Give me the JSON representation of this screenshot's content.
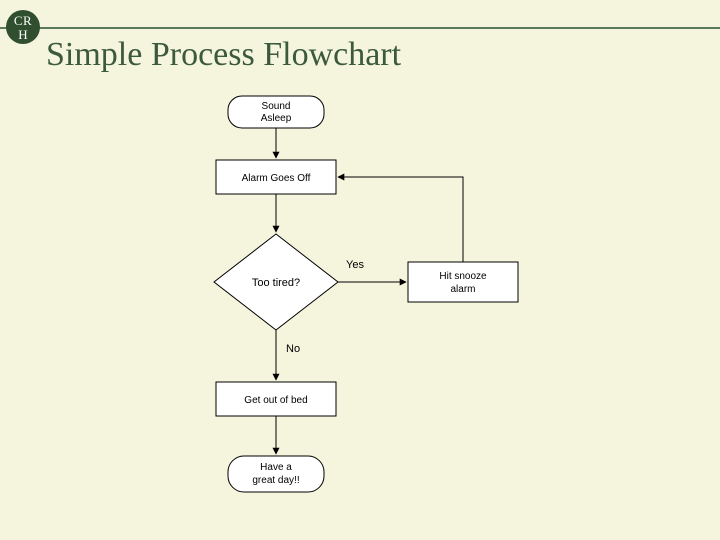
{
  "logo": {
    "top": "CR",
    "bottom": "H"
  },
  "title": "Simple Process Flowchart",
  "nodes": {
    "start": {
      "l1": "Sound",
      "l2": "Asleep"
    },
    "alarm": {
      "l1": "Alarm Goes Off"
    },
    "tired": {
      "l1": "Too tired?"
    },
    "snooze": {
      "l1": "Hit snooze",
      "l2": "alarm"
    },
    "getup": {
      "l1": "Get out of bed"
    },
    "end": {
      "l1": "Have a",
      "l2": "great  day!!"
    }
  },
  "edges": {
    "yes": "Yes",
    "no": "No"
  }
}
